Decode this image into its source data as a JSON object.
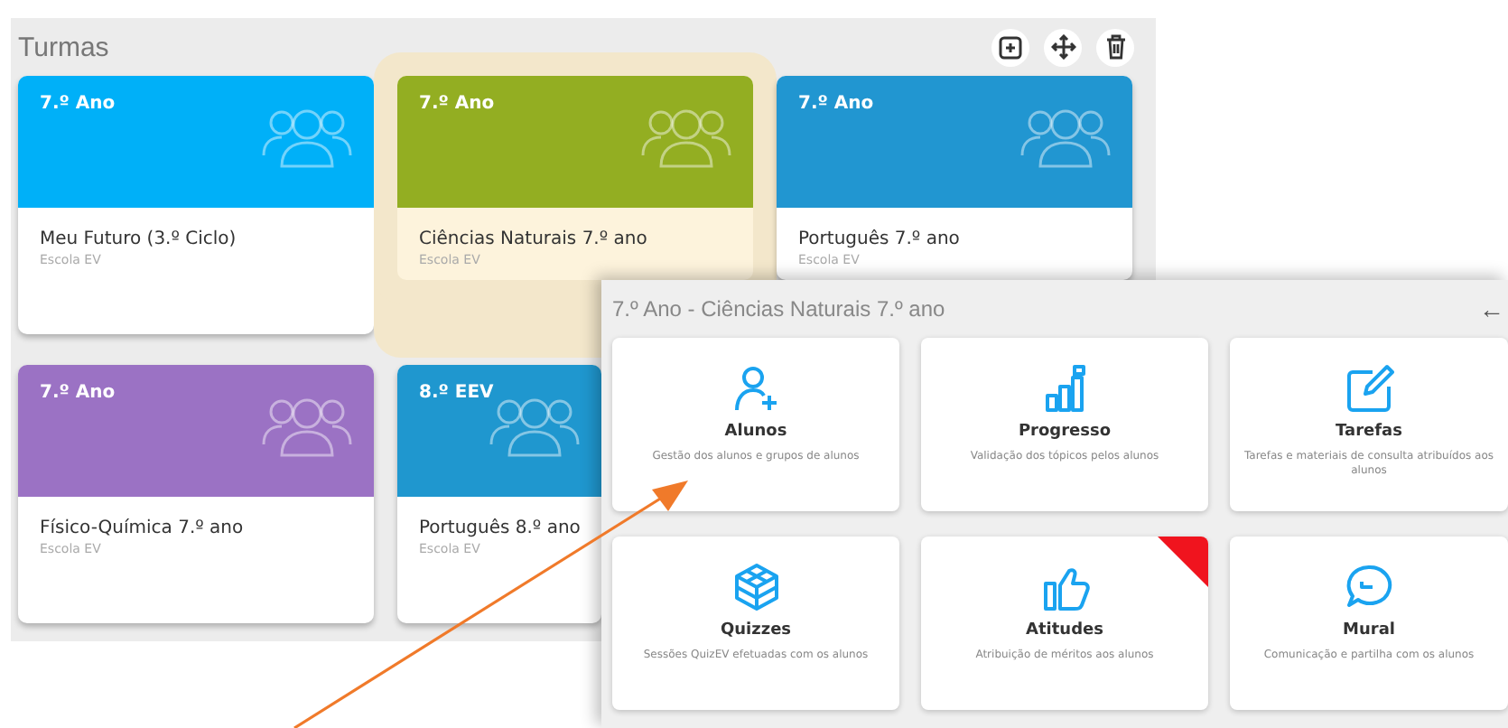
{
  "panel": {
    "title": "Turmas"
  },
  "classes": [
    {
      "grade": "7.º Ano",
      "name": "Meu Futuro (3.º Ciclo)",
      "school": "Escola EV",
      "color": "#00b0f8",
      "selected": false
    },
    {
      "grade": "7.º Ano",
      "name": "Ciências Naturais 7.º ano",
      "school": "Escola EV",
      "color": "#93ae22",
      "selected": true
    },
    {
      "grade": "7.º Ano",
      "name": "Português 7.º ano",
      "school": "Escola EV",
      "color": "#2196d1",
      "selected": false
    },
    {
      "grade": "7.º Ano",
      "name": "Físico-Química 7.º ano",
      "school": "Escola EV",
      "color": "#9b72c4",
      "selected": false
    },
    {
      "grade": "8.º EEV",
      "name": "Português 8.º ano",
      "school": "Escola EV",
      "color": "#1f97cf",
      "selected": false
    }
  ],
  "class_menu": {
    "title": "7.º Ano - Ciências Naturais 7.º ano",
    "back": "←",
    "tiles": [
      {
        "title": "Alunos",
        "description": "Gestão dos alunos e grupos de alunos",
        "ribbon": false
      },
      {
        "title": "Progresso",
        "description": "Validação dos tópicos pelos alunos",
        "ribbon": false
      },
      {
        "title": "Tarefas",
        "description": "Tarefas e materiais de consulta atribuídos aos alunos",
        "ribbon": false
      },
      {
        "title": "Quizzes",
        "description": "Sessões QuizEV efetuadas com os alunos",
        "ribbon": false
      },
      {
        "title": "Atitudes",
        "description": "Atribuição de méritos aos alunos",
        "ribbon": true
      },
      {
        "title": "Mural",
        "description": "Comunicação e partilha com os alunos",
        "ribbon": false
      }
    ]
  }
}
